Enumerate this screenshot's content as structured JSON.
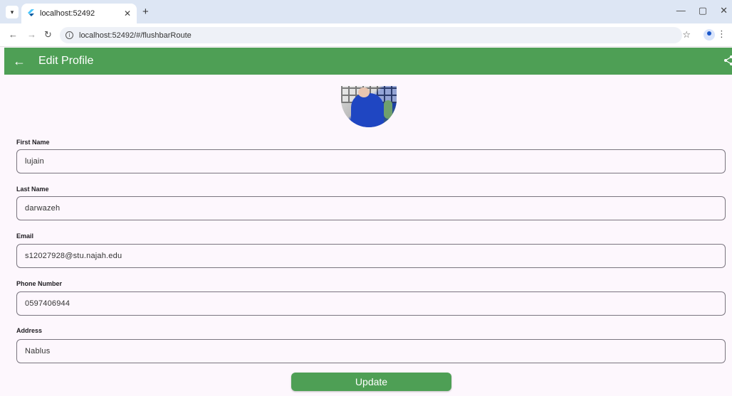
{
  "browser": {
    "tab_title": "localhost:52492",
    "url": "localhost:52492/#/flushbarRoute"
  },
  "appbar": {
    "title": "Edit Profile"
  },
  "form": {
    "fields": [
      {
        "label": "First Name",
        "value": "lujain"
      },
      {
        "label": "Last Name",
        "value": "darwazeh"
      },
      {
        "label": "Email",
        "value": "s12027928@stu.najah.edu"
      },
      {
        "label": "Phone Number",
        "value": "0597406944"
      },
      {
        "label": "Address",
        "value": "Nablus"
      }
    ],
    "submit_label": "Update"
  },
  "colors": {
    "accent": "#4e9f55",
    "background": "#fdf7fd"
  },
  "icons": [
    "back-arrow-icon",
    "share-icon",
    "info-icon",
    "star-icon",
    "profile-icon"
  ]
}
